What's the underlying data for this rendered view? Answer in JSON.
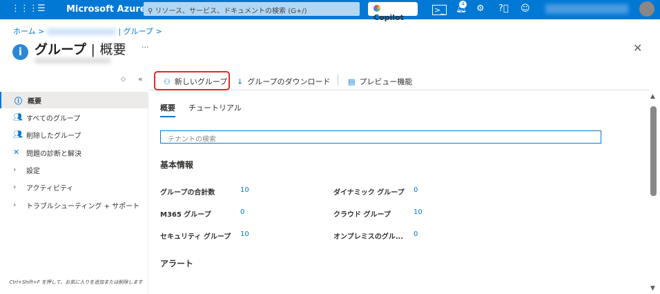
{
  "topbar": {
    "brand": "Microsoft Azure",
    "search_placeholder": "リソース、サービス、ドキュメントの検索 (G+/)",
    "copilot": "Copilot",
    "notification_count": "4",
    "accent": "#0078d4"
  },
  "breadcrumb": {
    "home": "ホーム",
    "sep": ">",
    "current": "| グループ"
  },
  "page": {
    "title": "グループ",
    "title_sep": "|",
    "title_section": "概要",
    "more": "···"
  },
  "sidebar": {
    "items": [
      {
        "label": "概要",
        "icon": "info-icon"
      },
      {
        "label": "すべてのグループ",
        "icon": "group-icon"
      },
      {
        "label": "削除したグループ",
        "icon": "group-icon"
      },
      {
        "label": "問題の診断と解決",
        "icon": "tools-icon"
      },
      {
        "label": "設定",
        "icon": "chevron-right-icon"
      },
      {
        "label": "アクティビティ",
        "icon": "chevron-right-icon"
      },
      {
        "label": "トラブルシューティング + サポート",
        "icon": "chevron-right-icon"
      }
    ],
    "hint": "Ctrl+Shift+F を押して、お気に入りを追加または削除します"
  },
  "toolbar": {
    "new_group": "新しいグループ",
    "download": "グループのダウンロード",
    "preview": "プレビュー機能"
  },
  "tabs": [
    "概要",
    "チュートリアル"
  ],
  "tenant_search": {
    "placeholder": "テナントの検索"
  },
  "basic": {
    "heading": "基本情報",
    "stats": [
      {
        "label": "グループの合計数",
        "value": "10"
      },
      {
        "label": "M365 グループ",
        "value": "0"
      },
      {
        "label": "セキュリティ グループ",
        "value": "10"
      },
      {
        "label": "ダイナミック グループ",
        "value": "0"
      },
      {
        "label": "クラウド グループ",
        "value": "10"
      },
      {
        "label": "オンプレミスのグル...",
        "value": "0"
      }
    ]
  },
  "alerts": {
    "heading": "アラート"
  }
}
